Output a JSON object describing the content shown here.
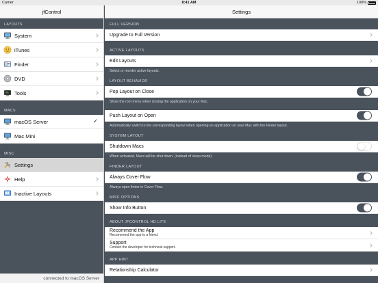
{
  "status_bar": {
    "carrier": "Carrier",
    "time": "8:41 AM",
    "battery": "100%"
  },
  "sidebar": {
    "title": "jfControl",
    "sections": [
      {
        "label": "LAYOUTS",
        "items": [
          {
            "label": "System",
            "icon": "system-icon",
            "accessory": "chevron"
          },
          {
            "label": "iTunes",
            "icon": "itunes-icon",
            "accessory": "chevron"
          },
          {
            "label": "Finder",
            "icon": "finder-icon",
            "accessory": "chevron"
          },
          {
            "label": "DVD",
            "icon": "dvd-icon",
            "accessory": "chevron"
          },
          {
            "label": "Tools",
            "icon": "tools-icon",
            "accessory": "chevron"
          }
        ]
      },
      {
        "label": "MACS",
        "items": [
          {
            "label": "macOS Server",
            "icon": "mac-icon",
            "accessory": "check"
          },
          {
            "label": "Mac Mini",
            "icon": "mac-icon",
            "accessory": "none"
          }
        ]
      },
      {
        "label": "MISC",
        "items": [
          {
            "label": "Settings",
            "icon": "settings-icon",
            "accessory": "none",
            "selected": true
          },
          {
            "label": "Help",
            "icon": "help-icon",
            "accessory": "chevron"
          },
          {
            "label": "Inactive Layouts",
            "icon": "inactive-layouts-icon",
            "accessory": "chevron"
          }
        ]
      }
    ],
    "footer": "connected to macOS Server"
  },
  "main": {
    "title": "Settings",
    "sections": {
      "full_version": "FULL VERSION",
      "active_layouts": "ACTIVE LAYOUTS",
      "layout_behavior": "LAYOUT BEHAVIOR",
      "system_layout": "SYSTEM LAYOUT",
      "finder_layout": "FINDER LAYOUT",
      "misc_options": "MISC OPTIONS",
      "about": "ABOUT JFCONTROL HD LITE",
      "app_hint": "APP HINT"
    },
    "rows": {
      "upgrade": "Upgrade to Full Version",
      "edit_layouts": "Edit Layouts",
      "edit_layouts_footer": "Select or reorder active layouts.",
      "pop_layout": "Pop Layout on Close",
      "pop_layout_footer": "Show the root menu when closing the application on your Mac.",
      "push_layout": "Push Layout on Open",
      "push_layout_footer": "Automatically switch to the corresponding layout when opening an application on your Mac with the Finder layout.",
      "shutdown": "Shutdown Macs",
      "shutdown_footer": "When activated, Macs will be shut down. (instead of sleep mode)",
      "cover_flow": "Always Cover Flow",
      "cover_flow_footer": "Always open finder in Cover Flow.",
      "show_info": "Show Info Button",
      "recommend": "Recommend the App",
      "recommend_sub": "Recommend the app to a friend.",
      "support": "Support",
      "support_sub": "Contact the developer for technical support.",
      "relationship": "Relationship Calculator"
    },
    "toggles": {
      "pop_layout": true,
      "push_layout": true,
      "shutdown": false,
      "cover_flow": true,
      "show_info": true
    }
  }
}
